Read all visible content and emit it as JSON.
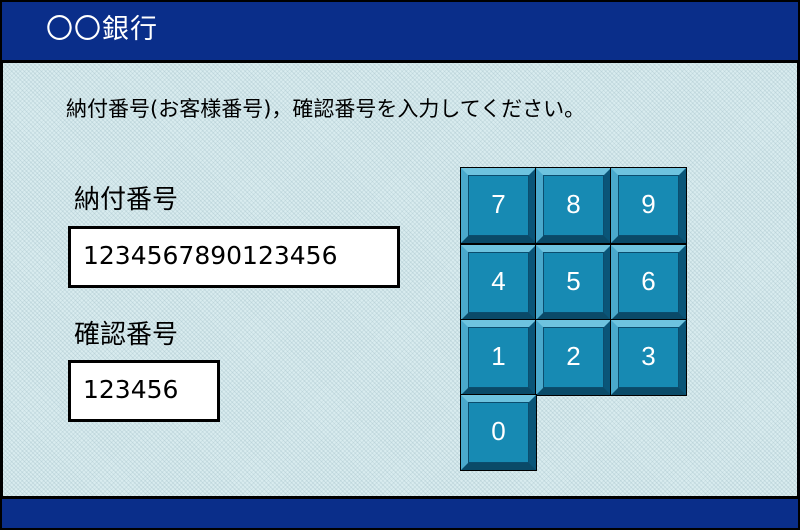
{
  "header": {
    "bank_name": "〇〇銀行"
  },
  "main": {
    "instruction": "納付番号(お客様番号)，確認番号を入力してください。",
    "payment_number": {
      "label": "納付番号",
      "value": "1234567890123456"
    },
    "confirmation_number": {
      "label": "確認番号",
      "value": "123456"
    }
  },
  "keypad": {
    "keys": [
      "7",
      "8",
      "9",
      "4",
      "5",
      "6",
      "1",
      "2",
      "3",
      "0"
    ]
  },
  "colors": {
    "header_bg": "#0a2e8a",
    "content_bg": "#d9ecef",
    "key_face": "#178ab3",
    "key_text": "#ffffff"
  }
}
